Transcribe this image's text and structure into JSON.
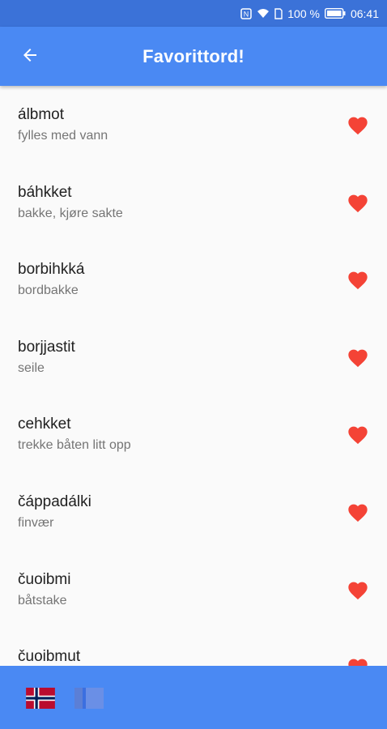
{
  "status_bar": {
    "battery": "100 %",
    "time": "06:41"
  },
  "header": {
    "title": "Favorittord!"
  },
  "words": [
    {
      "word": "álbmot",
      "translation": "fylles med vann"
    },
    {
      "word": "báhkket",
      "translation": "bakke, kjøre sakte"
    },
    {
      "word": "borbihkká",
      "translation": "bordbakke"
    },
    {
      "word": "borjjastit",
      "translation": "seile"
    },
    {
      "word": "cehkket",
      "translation": "trekke båten litt opp"
    },
    {
      "word": "čáppadálki",
      "translation": "finvær"
    },
    {
      "word": "čuoibmi",
      "translation": "båtstake"
    },
    {
      "word": "čuoibmut",
      "translation": ""
    }
  ],
  "colors": {
    "app_bar": "#4a89f3",
    "status_bar": "#3b72d8",
    "heart": "#f44336"
  },
  "icons": {
    "back": "arrow-left-icon",
    "favorite": "heart-icon",
    "language_1": "norway-flag-icon",
    "language_2": "sami-flag-icon"
  }
}
